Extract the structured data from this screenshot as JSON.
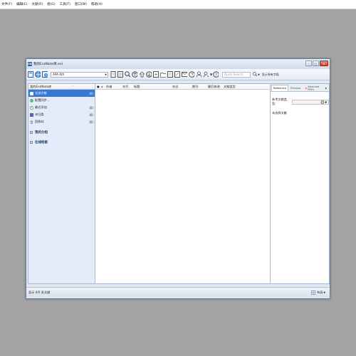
{
  "menubar": {
    "items": [
      "文件(F)",
      "编辑(E)",
      "文献(R)",
      "组(G)",
      "工具(T)",
      "窗口(W)",
      "帮助(H)"
    ]
  },
  "window": {
    "title": "我的EndNote库.enl"
  },
  "toolbar": {
    "style_value": "APA 6th",
    "quick_search_placeholder": "Quick Search",
    "search_option_label": "显示所有字段"
  },
  "left_panel": {
    "header": "我的EndNote库",
    "items": [
      {
        "label": "全部文献",
        "count": "(0)",
        "icon": "library-icon",
        "selected": true
      },
      {
        "label": "配置同步...",
        "count": "",
        "icon": "sync-icon",
        "selected": false
      },
      {
        "label": "最近添加",
        "count": "(0)",
        "icon": "recent-icon",
        "selected": false
      },
      {
        "label": "未归类",
        "count": "(0)",
        "icon": "unfiled-icon",
        "selected": false
      },
      {
        "label": "回收站",
        "count": "(0)",
        "icon": "trash-icon",
        "selected": false
      }
    ],
    "groups": [
      {
        "label": "我的分组"
      },
      {
        "label": "在线检索"
      }
    ]
  },
  "list": {
    "columns": [
      "作者",
      "年代",
      "标题",
      "杂志",
      "期刊",
      "最后修改",
      "文献类型"
    ]
  },
  "right_panel": {
    "tabs": [
      "Reference",
      "Preview",
      "Attached PDFs"
    ],
    "ref_type_label": "参考文献类型:",
    "no_selection": "未选择文献"
  },
  "statusbar": {
    "text": "显示 0/0 条文献",
    "layout_label": "布局"
  },
  "colors": {
    "background": "#a3a3a3",
    "selection": "#3877d3",
    "close_button": "#c6412b"
  }
}
